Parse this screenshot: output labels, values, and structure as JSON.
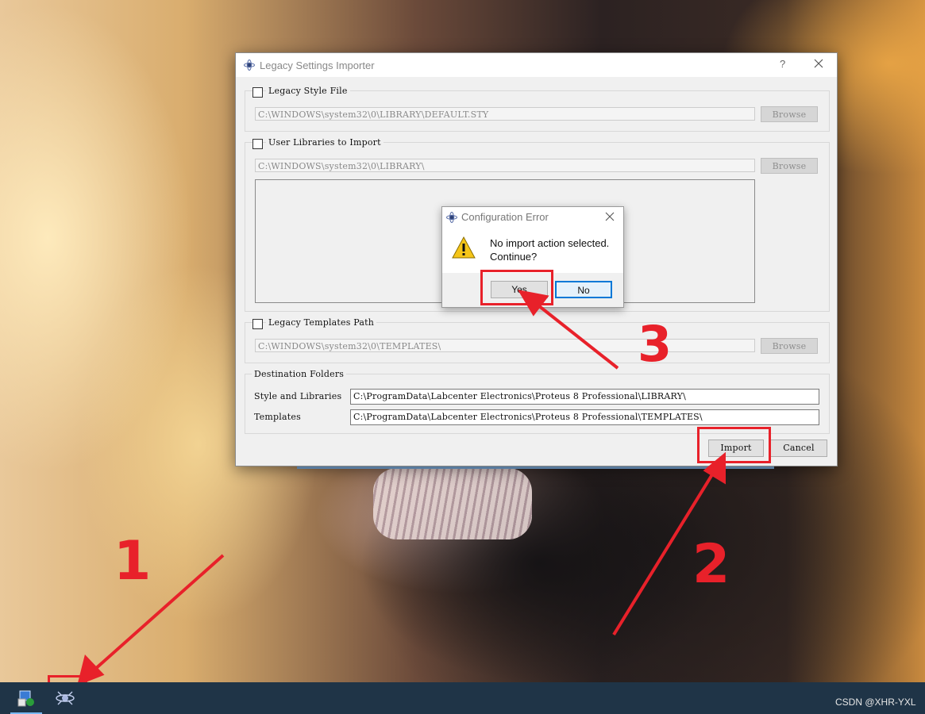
{
  "main_dialog": {
    "title": "Legacy Settings Importer",
    "help_label": "?",
    "legacy_style": {
      "label": "Legacy Style File",
      "path": "C:\\WINDOWS\\system32\\0\\LIBRARY\\DEFAULT.STY",
      "browse_label": "Browse"
    },
    "user_libraries": {
      "label": "User Libraries to Import",
      "path": "C:\\WINDOWS\\system32\\0\\LIBRARY\\",
      "browse_label": "Browse"
    },
    "legacy_templates": {
      "label": "Legacy Templates Path",
      "path": "C:\\WINDOWS\\system32\\0\\TEMPLATES\\",
      "browse_label": "Browse"
    },
    "destination": {
      "heading": "Destination Folders",
      "style_libraries_label": "Style and Libraries",
      "style_libraries_value": "C:\\ProgramData\\Labcenter Electronics\\Proteus 8 Professional\\LIBRARY\\",
      "templates_label": "Templates",
      "templates_value": "C:\\ProgramData\\Labcenter Electronics\\Proteus 8 Professional\\TEMPLATES\\"
    },
    "import_label": "Import",
    "cancel_label": "Cancel"
  },
  "error_dialog": {
    "title": "Configuration Error",
    "message_line1": "No import action selected.",
    "message_line2": "Continue?",
    "yes_label": "Yes",
    "no_label": "No"
  },
  "annotations": {
    "step1": "1",
    "step2": "2",
    "step3": "3",
    "color": "#e8212a"
  },
  "taskbar": {
    "items": [
      "installer-icon",
      "proteus-app-icon"
    ],
    "watermark": "CSDN @XHR-YXL"
  }
}
